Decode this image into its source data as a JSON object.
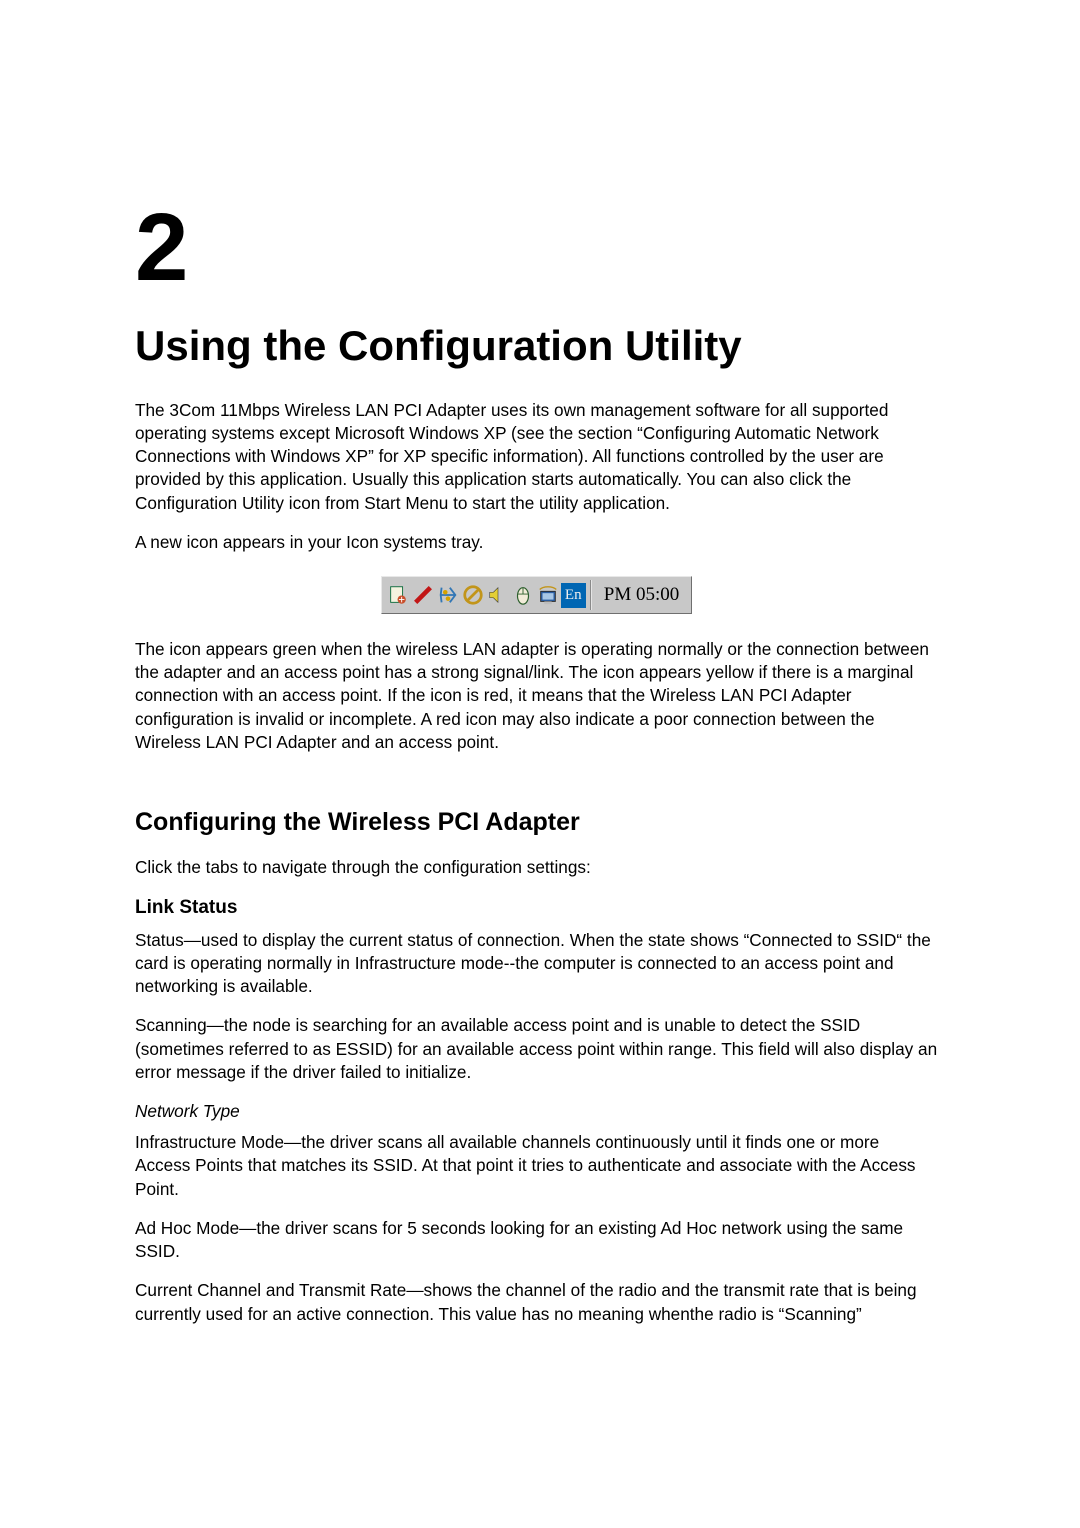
{
  "chapter": {
    "number": "2",
    "title": "Using the Configuration Utility"
  },
  "intro": {
    "p1": "The 3Com 11Mbps Wireless LAN PCI Adapter uses its own management software for all supported operating systems except Microsoft Windows XP (see the section “Configuring Automatic Network Connections with Windows XP” for XP specific information). All functions controlled by the user are provided by this application. Usually this application starts automatically. You can also click the Configuration Utility icon from Start Menu to start the utility application.",
    "p2": "A new icon appears in your Icon systems tray."
  },
  "tray": {
    "icons": [
      "doc-icon",
      "slash-icon",
      "transfer-icon",
      "cancel-icon",
      "sound-icon",
      "mouse-icon",
      "display-icon"
    ],
    "lang": "En",
    "time": "PM 05:00"
  },
  "after_tray": "The icon appears green when the wireless LAN adapter is operating normally or the connection between the adapter and an access point has a strong signal/link. The icon appears yellow if there is a marginal connection with an access point. If the icon is red, it means that the Wireless LAN PCI Adapter configuration is invalid or incomplete. A red icon may also indicate a poor connection between the Wireless LAN PCI Adapter and an access point.",
  "configuring": {
    "heading": "Configuring the Wireless PCI Adapter",
    "lead": "Click the tabs to navigate through the configuration settings:"
  },
  "link_status": {
    "heading": "Link Status",
    "status_p": "Status—used to display the current status of connection. When the state shows “Connected to SSID“ the card is operating normally in Infrastructure mode--the computer is connected to an access point and networking is available.",
    "scanning_p": "Scanning—the node is searching for an available access point and is unable to detect the SSID (sometimes referred to as ESSID) for an available access point within range. This field will also display an error message if the driver failed to initialize.",
    "network_type_head": "Network Type",
    "infra_p": "Infrastructure Mode—the driver scans all available channels continuously until it finds one or more Access Points that matches its SSID. At that point it tries to authenticate and associate with the Access Point.",
    "adhoc_p": "Ad Hoc Mode—the driver scans for 5 seconds looking for an existing Ad Hoc network using the same SSID.",
    "rate_p": "Current Channel and Transmit Rate—shows the channel of the radio and the transmit rate that is being currently used for an active connection. This value has no meaning whenthe radio is “Scanning”"
  }
}
